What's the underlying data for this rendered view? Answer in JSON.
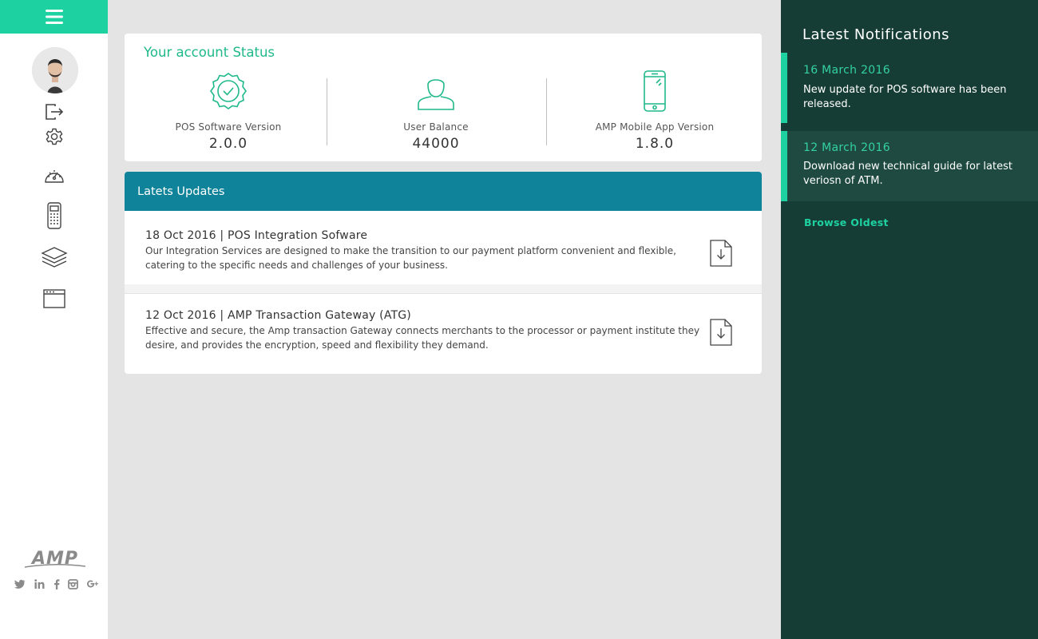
{
  "sidebar": {
    "icons": [
      "menu-icon",
      "logout-icon",
      "settings-icon",
      "dashboard-icon",
      "pos-terminal-icon",
      "layers-icon",
      "window-icon"
    ],
    "logo_text": "AMP",
    "social": [
      "twitter-icon",
      "linkedin-icon",
      "facebook-icon",
      "instagram-icon",
      "google-plus-icon"
    ]
  },
  "status": {
    "title": "Your account Status",
    "items": [
      {
        "label": "POS Software Version",
        "value": "2.0.0",
        "icon": "badge-check-icon"
      },
      {
        "label": "User Balance",
        "value": "44000",
        "icon": "user-icon"
      },
      {
        "label": "AMP Mobile App Version",
        "value": "1.8.0",
        "icon": "smartphone-icon"
      }
    ]
  },
  "updates": {
    "title": "Latets Updates",
    "items": [
      {
        "title": "18 Oct 2016  |  POS Integration Sofware",
        "desc": "Our Integration Services are designed to make the transition to our payment  platform convenient and flexible, catering to the specific needs and challenges of your business."
      },
      {
        "title": "12 Oct 2016  |  AMP Transaction Gateway (ATG)",
        "desc": "Effective and secure, the Amp transaction Gateway connects merchants to the processor or payment institute they desire, and provides the encryption, speed and flexibility they demand."
      }
    ]
  },
  "notifications": {
    "title": "Latest Notifications",
    "items": [
      {
        "date": "16  March 2016",
        "text": "New update for POS software has been released."
      },
      {
        "date": "12  March 2016",
        "text": "Download new technical guide for latest veriosn of ATM."
      }
    ],
    "browse": "Browse Oldest"
  },
  "colors": {
    "accent": "#1ed1a0",
    "header_teal": "#0e8399",
    "panel_dark": "#163d35",
    "status_green": "#1fb98a"
  }
}
